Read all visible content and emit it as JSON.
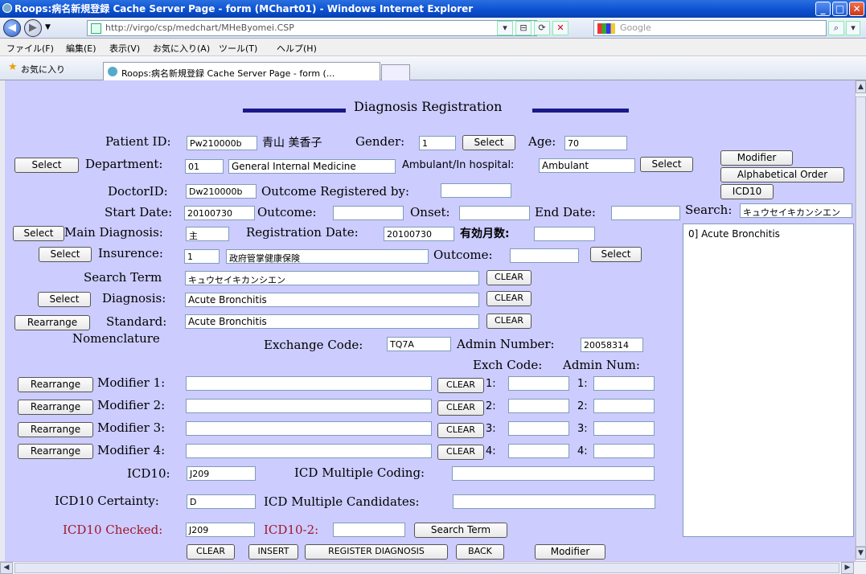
{
  "window": {
    "title": "Roops:病名新規登録  Cache Server Page - form (MChart01) - Windows Internet Explorer",
    "url": "http://virgo/csp/medchart/MHeByomei.CSP",
    "search_placeholder": "Google",
    "tab_label": "Roops:病名新規登録  Cache Server Page - form (..."
  },
  "menu": [
    "ファイル(F)",
    "編集(E)",
    "表示(V)",
    "お気に入り(A)",
    "ツール(T)",
    "ヘルプ(H)"
  ],
  "favorites_label": "お気に入り",
  "form": {
    "heading": "Diagnosis Registration",
    "patient_id_label": "Patient ID:",
    "patient_id": "Pw210000b",
    "patient_name": "青山 美香子",
    "gender_label": "Gender:",
    "gender": "1",
    "select": "Select",
    "age_label": "Age:",
    "age": "70",
    "modifier": "Modifier",
    "alphabetical_order": "Alphabetical Order",
    "icd10_btn": "ICD10",
    "department_label": "Department:",
    "department_code": "01",
    "department_name": "General Internal Medicine",
    "ambulant_label": "Ambulant/In hospital:",
    "ambulant": "Ambulant",
    "doctor_id_label": "DoctorID:",
    "doctor_id": "Dw210000b",
    "outcome_registered_label": "Outcome Registered by:",
    "start_date_label": "Start Date:",
    "start_date": "20100730",
    "outcome_label": "Outcome:",
    "onset_label": "Onset:",
    "end_date_label": "End Date:",
    "search_label": "Search:",
    "search_value": "キュウセイキカンシエン",
    "main_diagnosis_label": "Main Diagnosis:",
    "main_diagnosis": "主",
    "registration_date_label": "Registration Date:",
    "registration_date": "20100730",
    "valid_months_label": "有効月数:",
    "insurance_label": "Insurence:",
    "insurance_code": "1",
    "insurance_name": "政府管掌健康保険",
    "search_term_label": "Search Term",
    "search_term": "キュウセイキカンシエン",
    "clear": "CLEAR",
    "diagnosis_label": "Diagnosis:",
    "diagnosis": "Acute  Bronchitis",
    "rearrange": "Rearrange",
    "standard_label": "Standard:",
    "standard": "Acute  Bronchitis",
    "nomenclature_label": "Nomenclature",
    "exchange_code_label": "Exchange Code:",
    "exchange_code": "TQ7A",
    "admin_number_label": "Admin Number:",
    "admin_number": "20058314",
    "exch_code_header": "Exch Code:",
    "admin_num_header": "Admin Num:",
    "modifiers": [
      {
        "label": "Modifier 1:",
        "n1": "1:",
        "n2": "1:"
      },
      {
        "label": "Modifier 2:",
        "n1": "2:",
        "n2": "2:"
      },
      {
        "label": "Modifier 3:",
        "n1": "3:",
        "n2": "3:"
      },
      {
        "label": "Modifier 4:",
        "n1": "4:",
        "n2": "4:"
      }
    ],
    "icd10_label": "ICD10:",
    "icd10": "J209",
    "icd_multiple_coding_label": "ICD Multiple Coding:",
    "icd10_certainty_label": "ICD10  Certainty:",
    "icd10_certainty": "D",
    "icd_multiple_candidates_label": "ICD Multiple Candidates:",
    "icd10_checked_label": "ICD10 Checked:",
    "icd10_checked": "J209",
    "icd10_2_label": "ICD10-2:",
    "search_term_btn": "Search Term",
    "insert": "INSERT",
    "register_diagnosis": "REGISTER DIAGNOSIS",
    "back": "BACK",
    "results": [
      "0] Acute  Bronchitis"
    ]
  }
}
